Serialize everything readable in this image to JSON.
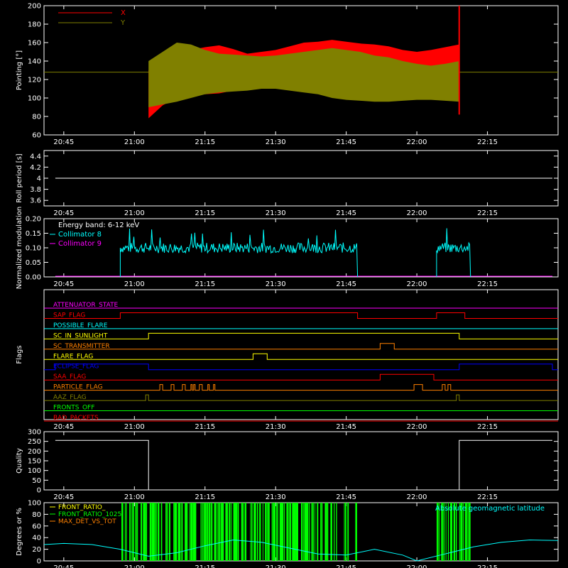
{
  "background": "#000000",
  "foreground": "#ffffff",
  "time_ticks": [
    "20:45",
    "21:00",
    "21:15",
    "21:30",
    "21:45",
    "22:00",
    "22:15"
  ],
  "time_ticks_hours": [
    20.75,
    21.0,
    21.25,
    21.5,
    21.75,
    22.0,
    22.25
  ],
  "chart_data": [
    {
      "id": "pointing",
      "type": "area",
      "ylabel": "Pointing [°]",
      "xlim": [
        20.68,
        22.5
      ],
      "ylim": [
        60,
        200
      ],
      "yticks": [
        60,
        80,
        100,
        120,
        140,
        160,
        180,
        200
      ],
      "x_domain_hours": [
        21.05,
        22.15
      ],
      "baseline": 128,
      "legend": [
        {
          "label": "X",
          "color": "#ff0000"
        },
        {
          "label": "Y",
          "color": "#808000"
        }
      ],
      "series": [
        {
          "name": "X",
          "color": "#ff0000",
          "x": [
            21.05,
            21.1,
            21.15,
            21.2,
            21.25,
            21.3,
            21.35,
            21.4,
            21.45,
            21.5,
            21.55,
            21.6,
            21.65,
            21.7,
            21.75,
            21.8,
            21.85,
            21.9,
            21.95,
            22.0,
            22.05,
            22.1,
            22.15
          ],
          "upper": [
            130,
            137,
            148,
            152,
            155,
            157,
            153,
            148,
            150,
            152,
            156,
            160,
            161,
            163,
            161,
            159,
            158,
            156,
            152,
            150,
            152,
            155,
            158
          ],
          "lower": [
            78,
            92,
            100,
            103,
            104,
            105,
            108,
            110,
            110,
            112,
            110,
            108,
            106,
            104,
            106,
            108,
            110,
            112,
            114,
            112,
            110,
            108,
            106
          ]
        },
        {
          "name": "Y",
          "color": "#808000",
          "x": [
            21.05,
            21.1,
            21.15,
            21.2,
            21.25,
            21.3,
            21.35,
            21.4,
            21.45,
            21.5,
            21.55,
            21.6,
            21.65,
            21.7,
            21.75,
            21.8,
            21.85,
            21.9,
            21.95,
            22.0,
            22.05,
            22.1,
            22.15
          ],
          "upper": [
            140,
            150,
            160,
            158,
            152,
            148,
            147,
            146,
            145,
            146,
            148,
            150,
            152,
            154,
            152,
            150,
            146,
            144,
            140,
            137,
            135,
            137,
            140
          ],
          "lower": [
            90,
            93,
            96,
            100,
            104,
            106,
            107,
            108,
            110,
            110,
            108,
            106,
            104,
            100,
            98,
            97,
            96,
            96,
            97,
            98,
            98,
            97,
            96
          ]
        }
      ]
    },
    {
      "id": "roll",
      "type": "line",
      "ylabel": "Roll period [s]",
      "xlim": [
        20.68,
        22.5
      ],
      "ylim": [
        3.5,
        4.5
      ],
      "yticks": [
        3.6,
        3.8,
        4.0,
        4.2,
        4.4
      ],
      "series": [
        {
          "name": "",
          "color": "#ffffff",
          "x": [
            20.72,
            22.48
          ],
          "y": [
            4.0,
            4.0
          ]
        }
      ]
    },
    {
      "id": "modulation",
      "type": "line",
      "ylabel": "Normalized modulation",
      "xlim": [
        20.68,
        22.5
      ],
      "ylim": [
        0,
        0.2
      ],
      "yticks": [
        0.0,
        0.05,
        0.1,
        0.15,
        0.2
      ],
      "yticklabels": [
        "0.00",
        "0.05",
        "0.10",
        "0.15",
        "0.20"
      ],
      "annotation": "Energy band: 6-12 keV",
      "legend": [
        {
          "label": "Collimator 8",
          "color": "#00ffff"
        },
        {
          "label": "Collimator 9",
          "color": "#ff00ff"
        }
      ],
      "series": [
        {
          "name": "Collimator 8",
          "color": "#00ffff",
          "segments": [
            [
              20.95,
              21.79
            ],
            [
              22.07,
              22.19
            ]
          ],
          "mean": 0.1,
          "spread": 0.018
        },
        {
          "name": "Collimator 9",
          "color": "#ff00ff",
          "x": [
            20.72,
            22.48
          ],
          "y": [
            0.0,
            0.0
          ]
        }
      ]
    },
    {
      "id": "flags",
      "type": "line",
      "ylabel": "Flags",
      "xlim": [
        20.68,
        22.5
      ],
      "flags": [
        {
          "label": "ATTENUATOR_STATE",
          "color": "#ff00ff",
          "on": []
        },
        {
          "label": "SAP_FLAG",
          "color": "#ff0000",
          "on": [
            [
              20.95,
              21.79
            ],
            [
              22.07,
              22.17
            ]
          ]
        },
        {
          "label": "POSSIBLE_FLARE",
          "color": "#00ffff",
          "on": []
        },
        {
          "label": "SC_IN_SUNLIGHT",
          "color": "#ffff00",
          "on": [
            [
              21.05,
              22.15
            ]
          ]
        },
        {
          "label": "SC_TRANSMITTER",
          "color": "#ff8000",
          "on": [
            [
              21.87,
              21.92
            ]
          ]
        },
        {
          "label": "FLARE_FLAG",
          "color": "#ffff00",
          "on": [
            [
              21.42,
              21.47
            ]
          ]
        },
        {
          "label": "ECLIPSE_FLAG",
          "color": "#0000ff",
          "on": [
            [
              20.72,
              21.05
            ],
            [
              22.15,
              22.48
            ]
          ]
        },
        {
          "label": "SAA_FLAG",
          "color": "#ff0000",
          "on": [
            [
              21.87,
              22.06
            ]
          ]
        },
        {
          "label": "PARTICLE_FLAG",
          "color": "#ff8000",
          "on": [
            [
              21.09,
              21.1
            ],
            [
              21.13,
              21.14
            ],
            [
              21.17,
              21.18
            ],
            [
              21.2,
              21.205
            ],
            [
              21.21,
              21.215
            ],
            [
              21.23,
              21.24
            ],
            [
              21.26,
              21.265
            ],
            [
              21.28,
              21.285
            ],
            [
              21.99,
              22.02
            ],
            [
              22.09,
              22.1
            ],
            [
              22.11,
              22.12
            ]
          ]
        },
        {
          "label": "AAZ_FLAG",
          "color": "#808000",
          "on": [
            [
              21.04,
              21.05
            ],
            [
              22.14,
              22.15
            ]
          ]
        },
        {
          "label": "FRONTS_OFF",
          "color": "#00ff00",
          "on": []
        },
        {
          "label": "BAD_PACKETS",
          "color": "#ff0000",
          "on": []
        }
      ]
    },
    {
      "id": "quality",
      "type": "line",
      "ylabel": "Quality",
      "xlim": [
        20.68,
        22.5
      ],
      "ylim": [
        0,
        300
      ],
      "yticks": [
        0,
        50,
        100,
        150,
        200,
        250,
        300
      ],
      "series": [
        {
          "name": "",
          "color": "#ffffff",
          "x": [
            20.72,
            21.05,
            21.05,
            22.15,
            22.15,
            22.48
          ],
          "y": [
            255,
            255,
            0,
            0,
            255,
            255
          ]
        }
      ]
    },
    {
      "id": "ratios",
      "type": "line",
      "ylabel": "Degrees or %",
      "xlim": [
        20.68,
        22.5
      ],
      "ylim": [
        0,
        100
      ],
      "yticks": [
        0,
        20,
        40,
        60,
        80,
        100
      ],
      "legend": [
        {
          "label": "FRONT_RATIO_",
          "color": "#ffff00"
        },
        {
          "label": "FRONT_RATIO_1025",
          "color": "#00ff00"
        },
        {
          "label": "MAX_DET_VS_TOT",
          "color": "#ff8000"
        }
      ],
      "annotation": "Absolute geomagnetic latitude",
      "annotation_color": "#00ffff",
      "series": [
        {
          "name": "FRONT_RATIO_1025",
          "color": "#00ff00",
          "segments": [
            [
              20.95,
              21.79
            ],
            [
              22.07,
              22.19
            ]
          ]
        },
        {
          "name": "Absolute geomagnetic latitude",
          "color": "#00ffff",
          "x": [
            20.68,
            20.75,
            20.85,
            20.95,
            21.05,
            21.15,
            21.25,
            21.35,
            21.45,
            21.55,
            21.65,
            21.75,
            21.85,
            21.95,
            22.0,
            22.1,
            22.2,
            22.3,
            22.4,
            22.5
          ],
          "y": [
            28,
            30,
            28,
            20,
            8,
            14,
            26,
            36,
            32,
            22,
            12,
            10,
            20,
            10,
            0,
            12,
            24,
            32,
            36,
            35
          ]
        }
      ]
    }
  ]
}
